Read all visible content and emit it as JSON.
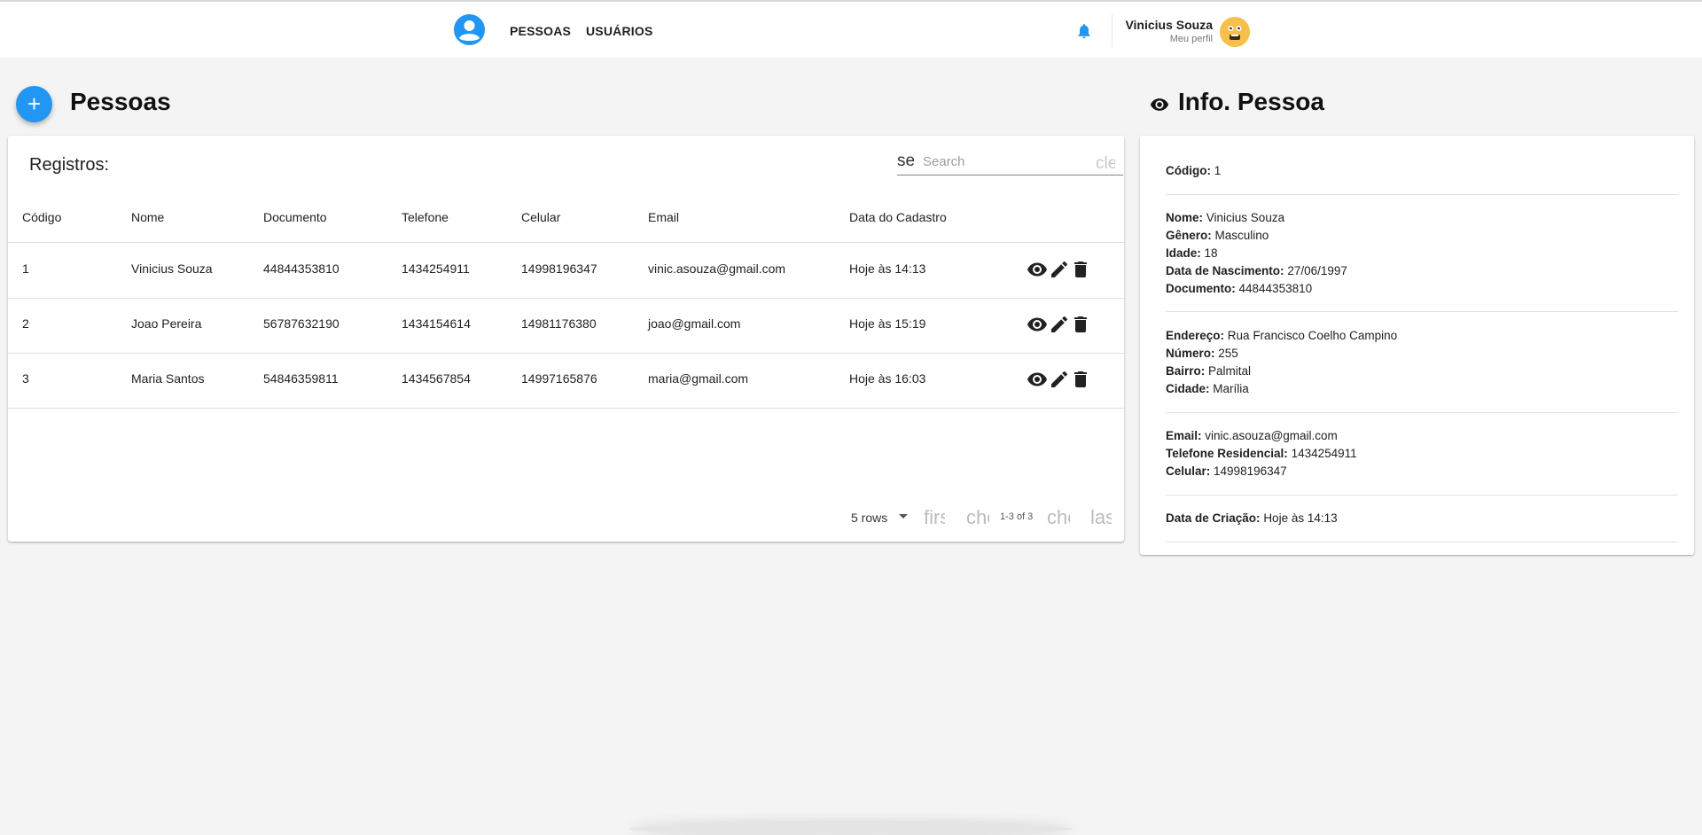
{
  "nav": {
    "items": [
      "PESSOAS",
      "USUÁRIOS"
    ],
    "user": {
      "name": "Vinicius Souza",
      "subtitle": "Meu perfil"
    },
    "accent": "#2196f3"
  },
  "main": {
    "title": "Pessoas",
    "fab_label": "+",
    "table": {
      "heading": "Registros:",
      "search": {
        "icon_text": "se",
        "placeholder": "Search",
        "clear_text": "clear"
      },
      "columns": [
        "Código",
        "Nome",
        "Documento",
        "Telefone",
        "Celular",
        "Email",
        "Data do Cadastro"
      ],
      "rows": [
        [
          "1",
          "Vinicius Souza",
          "44844353810",
          "1434254911",
          "14998196347",
          "vinic.asouza@gmail.com",
          "Hoje às 14:13"
        ],
        [
          "2",
          "Joao Pereira",
          "56787632190",
          "1434154614",
          "14981176380",
          "joao@gmail.com",
          "Hoje às 15:19"
        ],
        [
          "3",
          "Maria Santos",
          "54846359811",
          "1434567854",
          "14997165876",
          "maria@gmail.com",
          "Hoje às 16:03"
        ]
      ],
      "row_actions": [
        "eye-icon",
        "edit-icon",
        "delete-icon"
      ],
      "pagination": {
        "rows_per_page": "5 rows",
        "first": "first_page",
        "prev": "chevron_left",
        "count": "1-3 of 3",
        "next": "chevron_right",
        "last": "last_page"
      }
    }
  },
  "info": {
    "title": "Info. Pessoa",
    "codigo": {
      "label": "Código:",
      "value": "1"
    },
    "pessoal": [
      {
        "label": "Nome:",
        "value": "Vinicius Souza"
      },
      {
        "label": "Gênero:",
        "value": "Masculino"
      },
      {
        "label": "Idade:",
        "value": "18"
      },
      {
        "label": "Data de Nascimento:",
        "value": "27/06/1997"
      },
      {
        "label": "Documento:",
        "value": "44844353810"
      }
    ],
    "endereco": [
      {
        "label": "Endereço:",
        "value": "Rua Francisco Coelho Campino"
      },
      {
        "label": "Número:",
        "value": "255"
      },
      {
        "label": "Bairro:",
        "value": "Palmital"
      },
      {
        "label": "Cidade:",
        "value": "Marília"
      }
    ],
    "contato": [
      {
        "label": "Email:",
        "value": "vinic.asouza@gmail.com"
      },
      {
        "label": "Telefone Residencial:",
        "value": "1434254911"
      },
      {
        "label": "Celular:",
        "value": "14998196347"
      }
    ],
    "criacao": {
      "label": "Data de Criação:",
      "value": "Hoje às 14:13"
    }
  }
}
